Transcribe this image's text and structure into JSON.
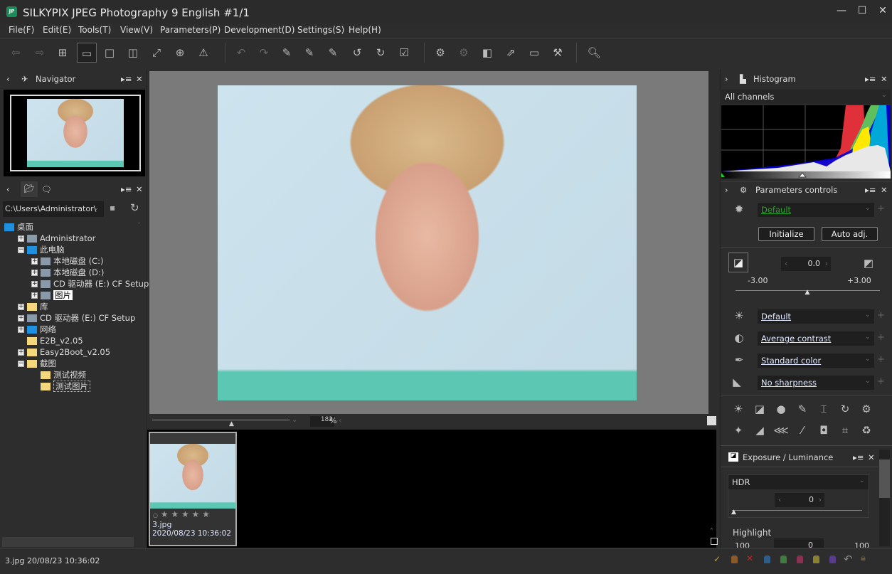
{
  "window": {
    "app_icon": "JP",
    "title": "SILKYPIX JPEG Photography 9 English   #1/1",
    "minimize": "—",
    "maximize": "☐",
    "close": "✕"
  },
  "menu": [
    "File(F)",
    "Edit(E)",
    "Tools(T)",
    "View(V)",
    "Parameters(P)",
    "Development(D)",
    "Settings(S)",
    "Help(H)"
  ],
  "navigator": {
    "title": "Navigator"
  },
  "browser": {
    "path": "C:\\Users\\Administrator\\",
    "tree": [
      {
        "label": "桌面",
        "level": 0,
        "exp": ""
      },
      {
        "label": "Administrator",
        "level": 1,
        "exp": "+"
      },
      {
        "label": "此电脑",
        "level": 1,
        "exp": "−"
      },
      {
        "label": "本地磁盘 (C:)",
        "level": 2,
        "exp": "+"
      },
      {
        "label": "本地磁盘 (D:)",
        "level": 2,
        "exp": "+"
      },
      {
        "label": "CD 驱动器 (E:) CF Setup",
        "level": 2,
        "exp": "+"
      },
      {
        "label": "图片",
        "level": 2,
        "exp": "+"
      },
      {
        "label": "库",
        "level": 1,
        "exp": "+"
      },
      {
        "label": "CD 驱动器 (E:) CF Setup",
        "level": 1,
        "exp": "+"
      },
      {
        "label": "网络",
        "level": 1,
        "exp": "+"
      },
      {
        "label": "E2B_v2.05",
        "level": 1,
        "exp": ""
      },
      {
        "label": "Easy2Boot_v2.05",
        "level": 1,
        "exp": "+"
      },
      {
        "label": "截图",
        "level": 1,
        "exp": "−"
      },
      {
        "label": "测试视频",
        "level": 2,
        "exp": ""
      },
      {
        "label": "测试图片",
        "level": 2,
        "exp": ""
      }
    ]
  },
  "viewer": {
    "zoom": "182",
    "zoom_unit": "%"
  },
  "filmstrip": {
    "items": [
      {
        "filename": "3.jpg",
        "datetime": "2020/08/23 10:36:02",
        "rating": 0
      }
    ]
  },
  "histogram": {
    "title": "Histogram",
    "channel": "All channels"
  },
  "params": {
    "title": "Parameters controls",
    "preset": "Default",
    "initialize": "Initialize",
    "auto_adj": "Auto adj.",
    "exposure": {
      "value": "0.0",
      "min": "-3.00",
      "max": "+3.00",
      "fraction": 0.5
    },
    "white_balance": "Default",
    "tone": "Average contrast",
    "color": "Standard color",
    "sharpness": "No sharpness"
  },
  "exposure_panel": {
    "title": "Exposure / Luminance",
    "hdr_label": "HDR",
    "hdr_value": "0",
    "highlight_label": "Highlight",
    "highlight_value": "0",
    "highlight_min": "100",
    "highlight_max": "100"
  },
  "status": {
    "text": "3.jpg 20/08/23 10:36:02"
  },
  "colors": {
    "accent_green": "#27a327",
    "bg": "#2d2d2d",
    "viewer_bg": "#7a7a7a"
  }
}
